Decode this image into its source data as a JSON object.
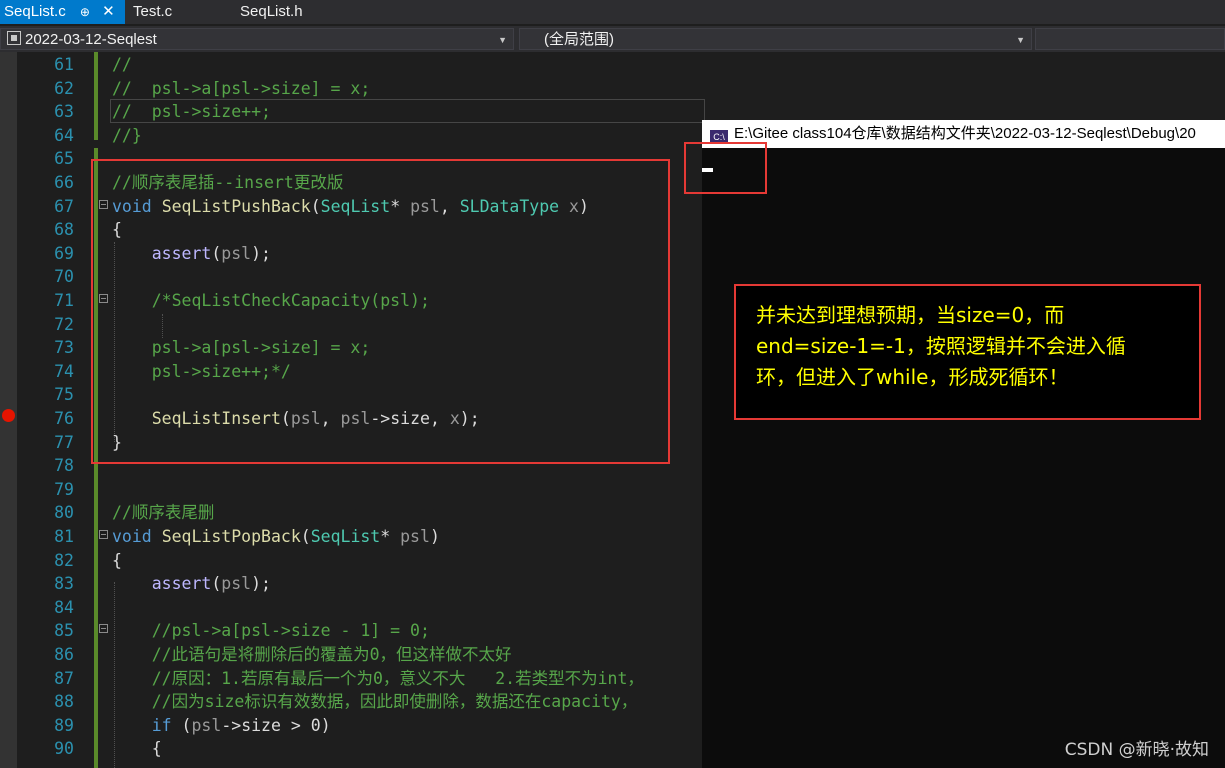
{
  "tabs": [
    {
      "label": "SeqList.c",
      "active": true
    },
    {
      "label": "Test.c",
      "active": false
    },
    {
      "label": "SeqList.h",
      "active": false
    }
  ],
  "tab_pin_glyph": "⊕",
  "tab_close_glyph": "✕",
  "navbar": {
    "project": "2022-03-12-Seqlest",
    "scope": "(全局范围)"
  },
  "code_lines": [
    {
      "num": "61"
    },
    {
      "num": "62"
    },
    {
      "num": "63"
    },
    {
      "num": "64"
    },
    {
      "num": "65"
    },
    {
      "num": "66"
    },
    {
      "num": "67"
    },
    {
      "num": "68"
    },
    {
      "num": "69"
    },
    {
      "num": "70"
    },
    {
      "num": "71"
    },
    {
      "num": "72"
    },
    {
      "num": "73"
    },
    {
      "num": "74"
    },
    {
      "num": "75"
    },
    {
      "num": "76"
    },
    {
      "num": "77"
    },
    {
      "num": "78"
    },
    {
      "num": "79"
    },
    {
      "num": "80"
    },
    {
      "num": "81"
    },
    {
      "num": "82"
    },
    {
      "num": "83"
    },
    {
      "num": "84"
    },
    {
      "num": "85"
    },
    {
      "num": "86"
    },
    {
      "num": "87"
    },
    {
      "num": "88"
    },
    {
      "num": "89"
    },
    {
      "num": "90"
    }
  ],
  "code": {
    "l61": "//",
    "l62": "//  psl->a[psl->size] = x;",
    "l63": "//  psl->size++;",
    "l64": "//}",
    "l66": "//顺序表尾插--insert更改版",
    "l67_kw": "void",
    "l67_fn": "SeqListPushBack",
    "l67_t1": "SeqList",
    "l67_p1": "psl",
    "l67_t2": "SLDataType",
    "l67_p2": "x",
    "l68": "{",
    "l69_fn": "assert",
    "l69_p": "psl",
    "l71": "/*SeqListCheckCapacity(psl);",
    "l73": "psl->a[psl->size] = x;",
    "l74": "psl->size++;*/",
    "l76_fn": "SeqListInsert",
    "l76_p1": "psl",
    "l76_p2": "psl",
    "l76_m": "size",
    "l76_p3": "x",
    "l77": "}",
    "l80": "//顺序表尾删",
    "l81_kw": "void",
    "l81_fn": "SeqListPopBack",
    "l81_t1": "SeqList",
    "l81_p1": "psl",
    "l82": "{",
    "l83_fn": "assert",
    "l83_p": "psl",
    "l85": "//psl->a[psl->size - 1] = 0;",
    "l86": "//此语句是将删除后的覆盖为0，但这样做不太好",
    "l87": "//原因：1.若原有最后一个为0，意义不大   2.若类型不为int，",
    "l88": "//因为size标识有效数据，因此即使删除，数据还在capacity，",
    "l89_kw": "if",
    "l89_p": "psl",
    "l89_m": "size",
    "l89_n": "0",
    "l90": "{"
  },
  "console": {
    "title": "E:\\Gitee class104仓库\\数据结构文件夹\\2022-03-12-Seqlest\\Debug\\20",
    "icon_text": "C:\\"
  },
  "note": {
    "line1": "并未达到理想预期，当size=0，而",
    "line2": "end=size-1=-1，按照逻辑并不会进入循",
    "line3": "环，但进入了while，形成死循环！"
  },
  "watermark": "CSDN @新晓·故知",
  "colors": {
    "comment": "#57a64a",
    "keyword": "#569cd6",
    "type": "#4ec9b0",
    "function": "#dcdcaa",
    "member": "#beb7ff",
    "param": "#9a9a9a",
    "note_text": "#ffff00",
    "annotation_red": "#e53935",
    "tab_active": "#007acc"
  }
}
